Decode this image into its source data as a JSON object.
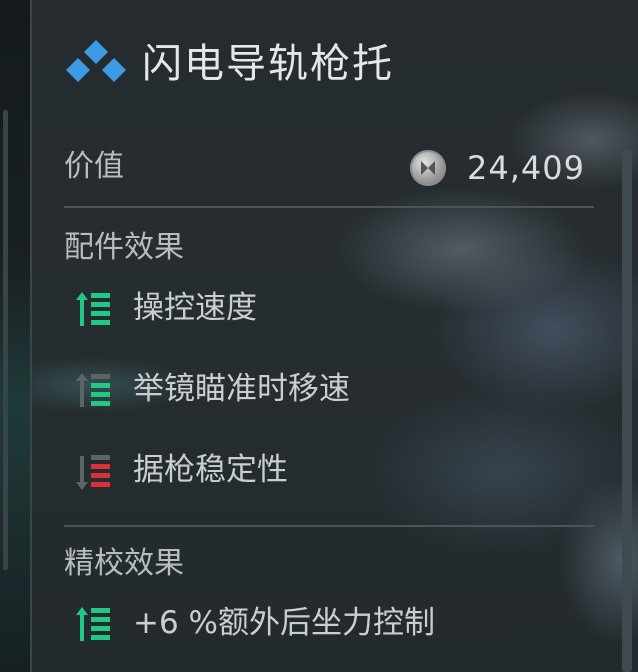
{
  "item": {
    "title": "闪电导轨枪托",
    "value_label": "价值",
    "price": "24,409",
    "currency_icon": "silver-coin-icon"
  },
  "attachment_effects": {
    "heading": "配件效果",
    "rows": [
      {
        "label": "操控速度",
        "icon": "stat-increase-icon",
        "color": "#22c984"
      },
      {
        "label": "举镜瞄准时移速",
        "icon": "stat-increase-icon",
        "color": "#22c984"
      },
      {
        "label": "据枪稳定性",
        "icon": "stat-decrease-icon",
        "color": "#d9313a"
      }
    ]
  },
  "tuning_effects": {
    "heading": "精校效果",
    "rows": [
      {
        "label": "+6 %额外后坐力控制",
        "icon": "stat-increase-icon",
        "color": "#22c984"
      }
    ]
  },
  "colors": {
    "accent_blue": "#3d9ae6",
    "increase_green": "#22c984",
    "decrease_red": "#d9313a"
  }
}
